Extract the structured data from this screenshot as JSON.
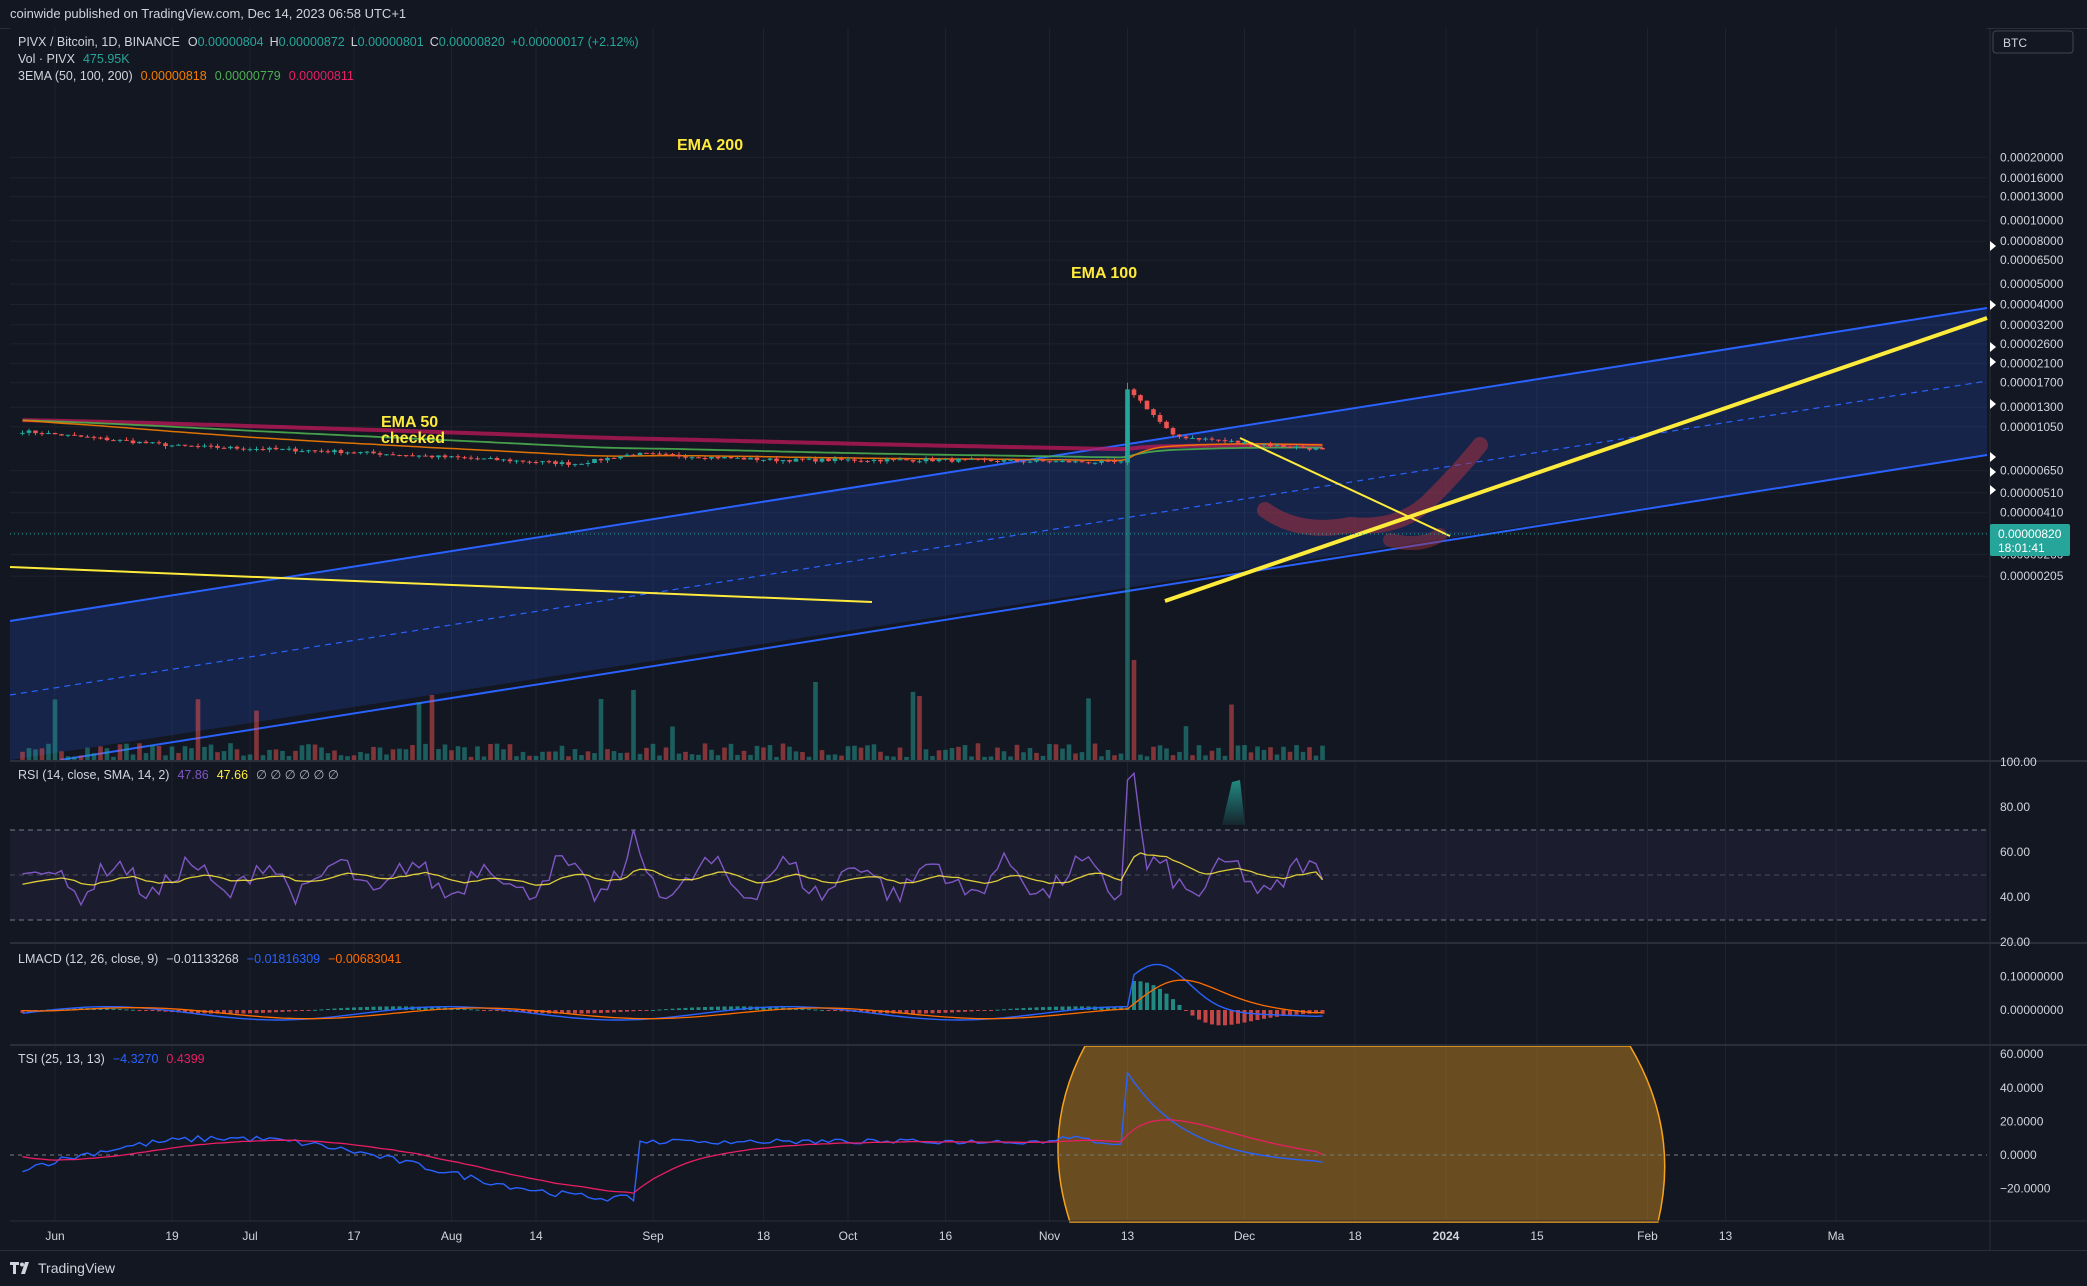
{
  "header": {
    "published": "coinwide published on TradingView.com, Dec 14, 2023 06:58 UTC+1"
  },
  "footer": {
    "brand": "TradingView"
  },
  "price_scale": {
    "currency": "BTC",
    "last_price": "0.00000820",
    "countdown": "18:01:41"
  },
  "legend": {
    "symbol": "PIVX / Bitcoin, 1D, BINANCE",
    "ohlc": [
      {
        "k": "O",
        "v": "0.00000804"
      },
      {
        "k": "H",
        "v": "0.00000872"
      },
      {
        "k": "L",
        "v": "0.00000801"
      },
      {
        "k": "C",
        "v": "0.00000820"
      }
    ],
    "change": "+0.00000017 (+2.12%)",
    "vol_label": "Vol · PIVX",
    "vol_value": "475.95K",
    "ema_label": "3EMA (50, 100, 200)",
    "ema_values": [
      "0.00000818",
      "0.00000779",
      "0.00000811"
    ],
    "rsi_label": "RSI (14, close, SMA, 14, 2)",
    "rsi_values": [
      "47.86",
      "47.66"
    ],
    "rsi_extras": "∅ ∅ ∅ ∅ ∅ ∅",
    "lmacd_label": "LMACD (12, 26, close, 9)",
    "lmacd_values": [
      "−0.01133268",
      "−0.01816309",
      "−0.00683041"
    ],
    "tsi_label": "TSI (25, 13, 13)",
    "tsi_values": [
      "−4.3270",
      "0.4399"
    ]
  },
  "annotations": [
    "EMA 200",
    "EMA 100",
    "EMA 50",
    "checked"
  ],
  "colors": {
    "background": "#131722",
    "up": "#26a69a",
    "down": "#ef5350",
    "ema50": "#f57c00",
    "ema100": "#4caf50",
    "ema200": "#c2185b",
    "channel": "#2962ff",
    "trendline": "#ffeb3b",
    "rsi": "#7e57c2",
    "macd": "#2962ff",
    "signal": "#ff6d00",
    "tsi": "#2962ff",
    "tsi_signal": "#e91e63",
    "highlight": "#f7a21b"
  },
  "chart_data": [
    {
      "type": "candlestick",
      "title": "PIVX / Bitcoin, 1D, BINANCE",
      "y_scale": "log",
      "y_ticks": [
        "0.00020000",
        "0.00016000",
        "0.00013000",
        "0.00010000",
        "0.00008000",
        "0.00006500",
        "0.00005000",
        "0.00004000",
        "0.00003200",
        "0.00002600",
        "0.00002100",
        "0.00001700",
        "0.00001300",
        "0.00001050",
        "0.00000650",
        "0.00000510",
        "0.00000410",
        "0.00000330",
        "0.00000260",
        "0.00000205"
      ],
      "x_ticks": [
        "Jun",
        "19",
        "Jul",
        "17",
        "Aug",
        "14",
        "Sep",
        "18",
        "Oct",
        "16",
        "Nov",
        "13",
        "Dec",
        "18",
        "2024",
        "15",
        "Feb",
        "13",
        "Ma"
      ],
      "price_anchors": [
        {
          "date": "2023-05-27",
          "close": 1e-05
        },
        {
          "date": "2023-06-20",
          "close": 8.5e-06
        },
        {
          "date": "2023-07-15",
          "close": 8e-06
        },
        {
          "date": "2023-08-20",
          "close": 7e-06
        },
        {
          "date": "2023-08-29",
          "close": 7.8e-06
        },
        {
          "date": "2023-09-20",
          "close": 7.3e-06
        },
        {
          "date": "2023-10-15",
          "close": 7.3e-06
        },
        {
          "date": "2023-11-12",
          "close": 7.1e-06
        },
        {
          "date": "2023-11-14",
          "close": 1.5e-05
        },
        {
          "date": "2023-11-20",
          "close": 9.5e-06
        },
        {
          "date": "2023-12-01",
          "close": 8.8e-06
        },
        {
          "date": "2023-12-13",
          "close": 8.2e-06
        }
      ],
      "ema": [
        {
          "name": "EMA 50",
          "last": "0.00000818"
        },
        {
          "name": "EMA 100",
          "last": "0.00000779"
        },
        {
          "name": "EMA 200",
          "last": "0.00000811"
        }
      ]
    },
    {
      "type": "line",
      "title": "RSI (14, close, SMA, 14, 2)",
      "y_ticks": [
        "100.00",
        "80.00",
        "60.00",
        "40.00",
        "20.00"
      ],
      "ylim": [
        20,
        100
      ],
      "bands": [
        30,
        50,
        70
      ],
      "last": {
        "rsi": 47.86,
        "sma": 47.66
      },
      "peak": {
        "date": "2023-11-14",
        "rsi": 95
      }
    },
    {
      "type": "line",
      "title": "LMACD (12, 26, close, 9)",
      "y_ticks": [
        "0.10000000",
        "0.00000000"
      ],
      "last": {
        "hist": -0.01133268,
        "macd": -0.01816309,
        "signal": -0.00683041
      }
    },
    {
      "type": "line",
      "title": "TSI (25, 13, 13)",
      "y_ticks": [
        "60.0000",
        "40.0000",
        "20.0000",
        "0.0000",
        "−20.0000"
      ],
      "ylim": [
        -35,
        65
      ],
      "last": {
        "tsi": -4.327,
        "signal": 0.4399
      },
      "peak": {
        "date": "2023-11-15",
        "tsi": 55
      }
    }
  ]
}
